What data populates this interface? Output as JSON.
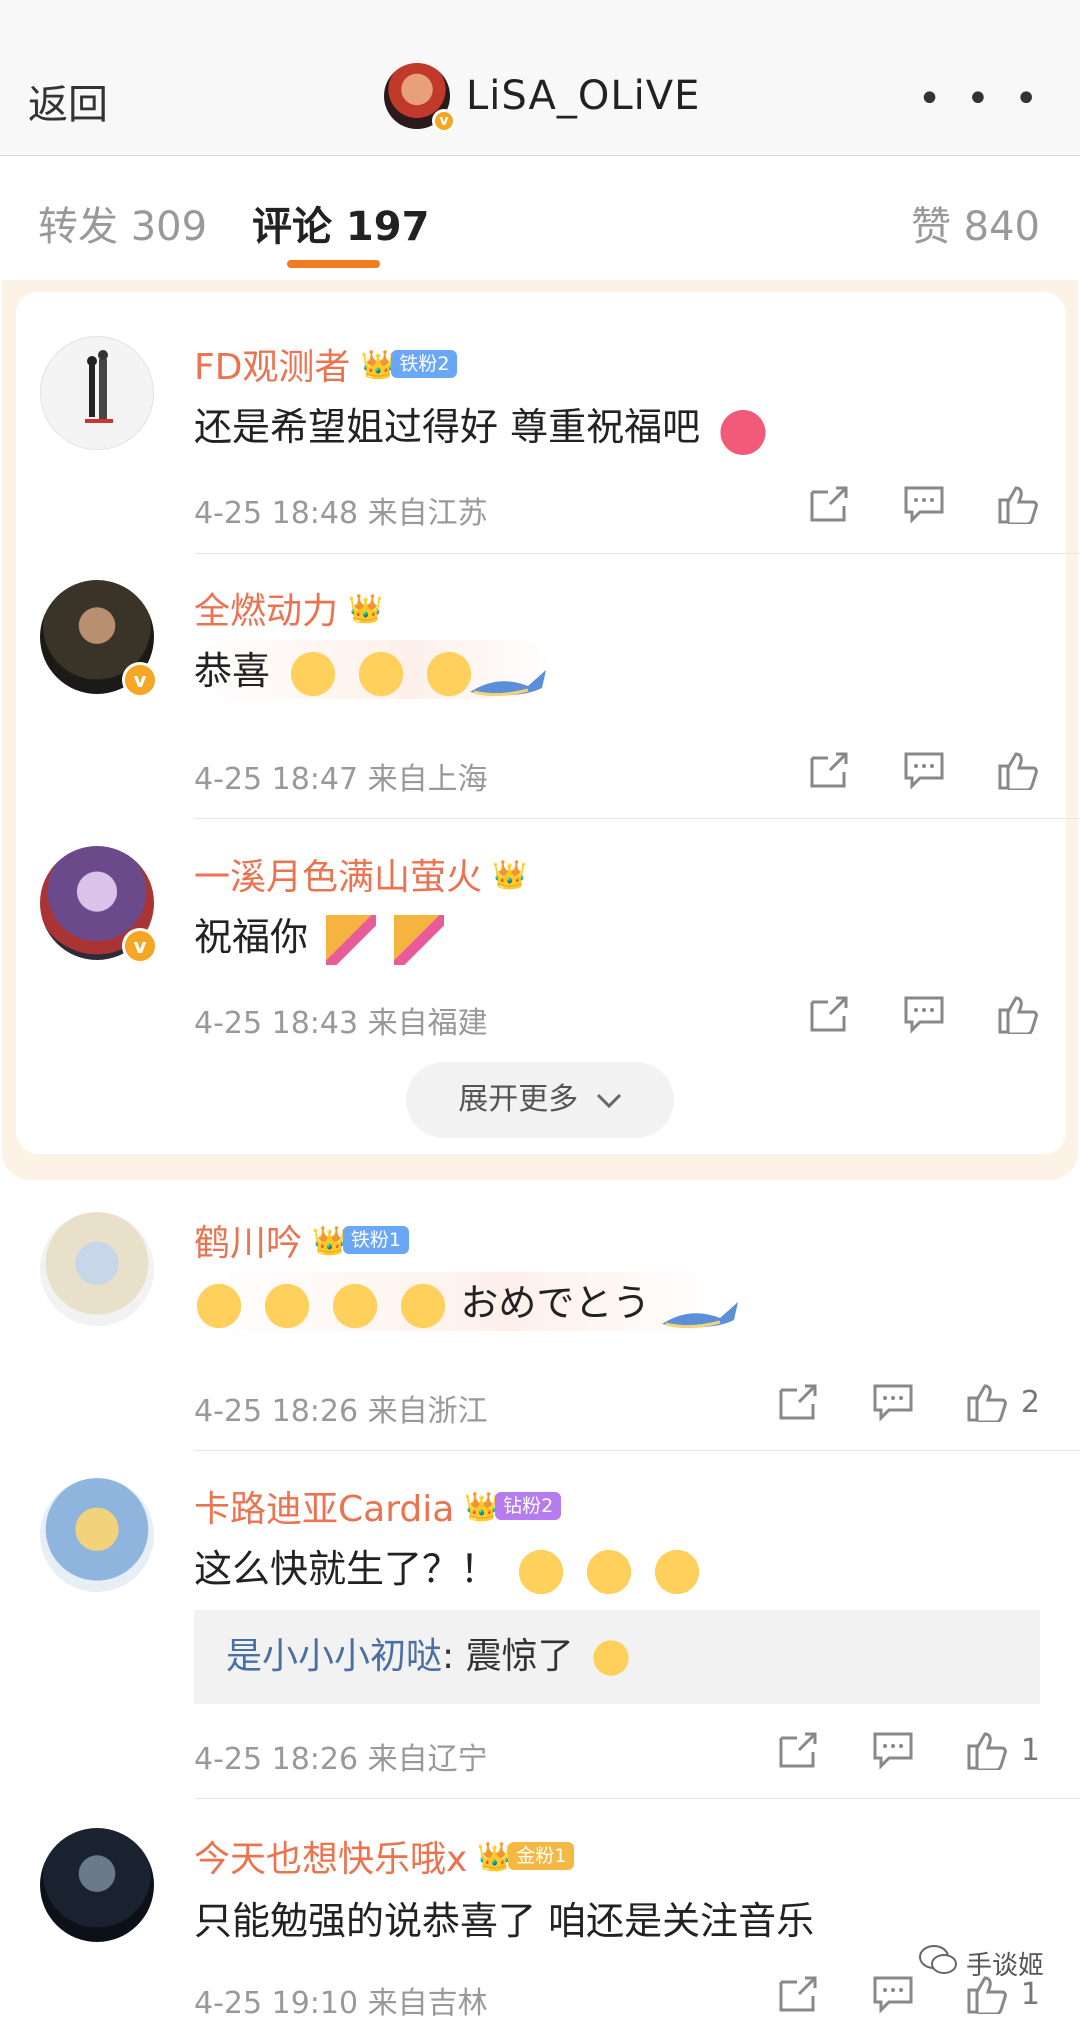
{
  "header": {
    "back_label": "返回",
    "title": "LiSA_OLiVE",
    "more_label": "• • •"
  },
  "tabs": {
    "repost": "转发 309",
    "comments": "评论 197",
    "likes": "赞 840"
  },
  "hot_comments": [
    {
      "name": "FD观测者",
      "fan_badge": "铁粉2",
      "fan_color": "#6aa8f7",
      "text": "还是希望姐过得好 尊重祝福吧",
      "time": "4-25 18:48",
      "location": "来自江苏",
      "verified": false,
      "emojis": [
        "heart-emoji"
      ]
    },
    {
      "name": "全燃动力",
      "fan_badge": "",
      "text": "恭喜",
      "time": "4-25 18:47",
      "location": "来自上海",
      "verified": true,
      "emojis": [
        "love-face-emoji",
        "love-face-emoji",
        "love-face-emoji"
      ]
    },
    {
      "name": "一溪月色满山萤火",
      "fan_badge": "",
      "text": "祝福你",
      "time": "4-25 18:43",
      "location": "来自福建",
      "verified": true,
      "emojis": [
        "party-popper-emoji",
        "party-popper-emoji"
      ]
    }
  ],
  "expand_label": "展开更多",
  "comments": [
    {
      "name": "鹤川吟",
      "fan_badge": "铁粉1",
      "fan_color": "#6aa8f7",
      "text": "おめでとう",
      "time": "4-25 18:26",
      "location": "来自浙江",
      "likes": "2",
      "emojis": [
        "crying-emoji",
        "crying-emoji",
        "crying-emoji",
        "crying-emoji"
      ]
    },
    {
      "name": "卡路迪亚Cardia",
      "fan_badge": "钻粉2",
      "fan_color": "#b57cf0",
      "text": "这么快就生了？！",
      "time": "4-25 18:26",
      "location": "来自辽宁",
      "likes": "1",
      "emojis": [
        "shocked-emoji",
        "shocked-emoji",
        "shocked-emoji"
      ],
      "reply": {
        "user": "是小小小初哒",
        "text": ": 震惊了"
      }
    },
    {
      "name": "今天也想快乐哦x",
      "fan_badge": "金粉1",
      "fan_color": "#f5b842",
      "text": "只能勉强的说恭喜了 咱还是关注音乐",
      "time": "4-25 19:10",
      "location": "来自吉林",
      "likes": "1",
      "emojis": []
    }
  ],
  "watermark": "手谈姬",
  "colors": {
    "accent": "#eb7350",
    "tab_underline": "#f07b20",
    "hot_panel": "#fdf2e6"
  }
}
